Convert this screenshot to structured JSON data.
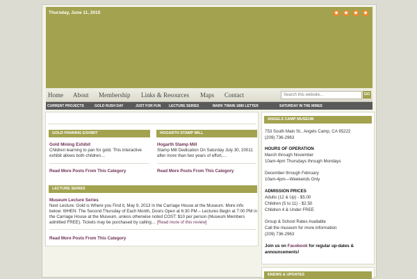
{
  "header": {
    "date": "Thursday, June 11, 2015"
  },
  "social_icons": [
    "rss-icon",
    "rss-icon",
    "rss-icon",
    "rss-icon"
  ],
  "nav": {
    "items": [
      "Home",
      "About",
      "Membership",
      "Links & Resources",
      "Maps",
      "Contact"
    ],
    "search_placeholder": "Search this website...",
    "go_label": "GO"
  },
  "subnav": {
    "items": [
      "CURRENT PROJECTS",
      "GOLD RUSH DAY",
      "JUST FOR FUN",
      "LECTURE SERIES",
      "MARK TWAIN 1880 LETTER",
      "SATURDAY IN THE MINES"
    ]
  },
  "gold_panning": {
    "heading": "GOLD PANNING EXHIBIT",
    "post_title": "Gold Mining Exhibit",
    "excerpt_1": "Children learning to pan for gold. This interactive",
    "excerpt_2": "exhibit allows both children…",
    "more": "Read More Posts From This Category"
  },
  "hogarth": {
    "heading": "HOGARTH STAMP MILL",
    "post_title": "Hogarth Stamp Mill",
    "excerpt_1": "Stamp Mill Dedication On Saturday July 30, 20011",
    "excerpt_2": "after more than two years of effort,…",
    "more": "Read More Posts From This Category"
  },
  "lecture": {
    "heading": "LECTURE SERIES",
    "post_title": "Museum Lecture Series",
    "line_1": "Next Lecture: Gold is Where you Find it, May 9, 2013  in the Carriage House at the Museum.  More info",
    "line_2": "below: WHEN: The Second  Thursday of Each Month, Doors Open at 6:30 PM – Lectures Begin at 7:00 PM in",
    "line_3": "the Carriage House at the Museum, unless otherwise noted COST: $10 per person (Museum Members",
    "line_4": "admitted FREE). Tickets may be purchased by calling…",
    "read_more_link": "[Read more of this review]",
    "more": "Read More Posts From This Category"
  },
  "sidebar": {
    "museum_heading": "ANGELS CAMP MUSEUM",
    "address": "753 South Main St., Angels Camp, CA 95222",
    "phone": "(209) 736-2963",
    "hours_heading": "HOURS OF OPERATION",
    "hours_1": "March through November",
    "hours_2": "10am-4pm Thursdays through Mondays",
    "hours_3": "December through February",
    "hours_4": "10am-4pm—Weekends Only",
    "prices_heading": "ADMISSION PRICES",
    "price_1": "Adults (12 & Up) - $5.00",
    "price_2": "Children (5 to 11) - $2.50",
    "price_3": "Children 4 & Under FREE",
    "group_1": "Group & School Rates Available",
    "group_2": "Call the museum for more information",
    "phone_2": "(209) 736-2963",
    "join_prefix": "Join us on ",
    "join_link": "Facebook",
    "join_suffix": " for regular up-dates &",
    "join_line2": "announcements!",
    "enews_heading": "ENEWS & UPDATES"
  },
  "colors": {
    "olive": "#a3a24f",
    "link_purple": "#6d2f55",
    "subnav_gray": "#5a5a5a"
  }
}
